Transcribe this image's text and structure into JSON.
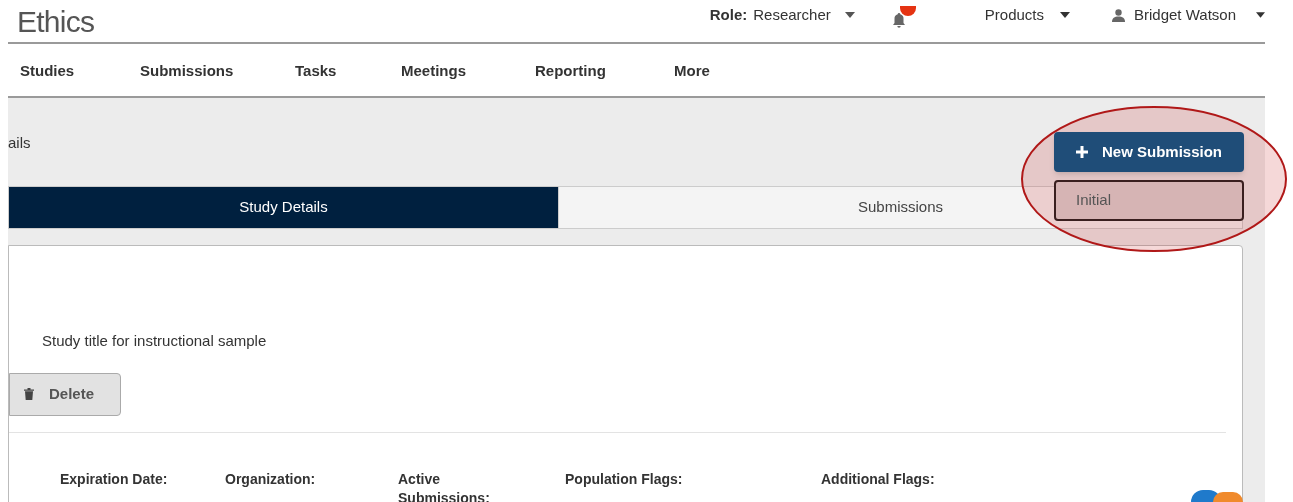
{
  "app": {
    "title": "Ethics"
  },
  "header": {
    "role_label": "Role:",
    "role_value": "Researcher",
    "products": "Products",
    "user": "Bridget Watson"
  },
  "nav": [
    "Studies",
    "Submissions",
    "Tasks",
    "Meetings",
    "Reporting",
    "More"
  ],
  "breadcrumb": "ails",
  "new_submission": {
    "label": "New Submission",
    "menu": [
      "Initial"
    ]
  },
  "tabs": [
    {
      "label": "Study Details",
      "selected": true
    },
    {
      "label": "Submissions",
      "selected": false
    }
  ],
  "study_title": "Study title for instructional sample",
  "delete_label": "Delete",
  "fields": [
    "Expiration Date:",
    "Organization:",
    "Active Submissions:",
    "Population Flags:",
    "Additional Flags:"
  ]
}
